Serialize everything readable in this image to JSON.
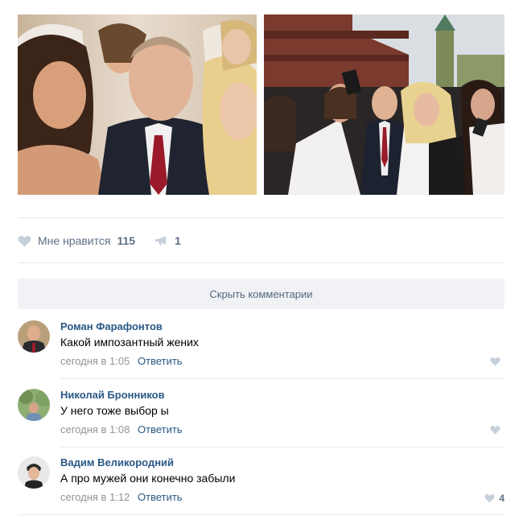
{
  "post": {
    "photos": [
      {
        "name": "photo-left-selfie"
      },
      {
        "name": "photo-right-red-square"
      }
    ],
    "actions": {
      "like_label": "Мне нравится",
      "like_count": "115",
      "share_count": "1"
    },
    "hide_comments_label": "Скрыть комментарии"
  },
  "comments": [
    {
      "author": "Роман Фарафонтов",
      "text": "Какой импозантный жених",
      "time": "сегодня в 1:05",
      "reply": "Ответить",
      "likes": ""
    },
    {
      "author": "Николай Бронников",
      "text": "У него тоже выбор ы",
      "time": "сегодня в 1:08",
      "reply": "Ответить",
      "likes": ""
    },
    {
      "author": "Вадим Великородний",
      "text": "А про мужей они конечно забыли",
      "time": "сегодня в 1:12",
      "reply": "Ответить",
      "likes": "4"
    }
  ],
  "icons": {
    "like": "heart-icon",
    "share": "megaphone-icon"
  },
  "colors": {
    "link": "#2a5885",
    "muted": "#939393",
    "action": "#5e6f86",
    "icon": "#c5d0db",
    "button_bg": "#f0f2f5"
  }
}
